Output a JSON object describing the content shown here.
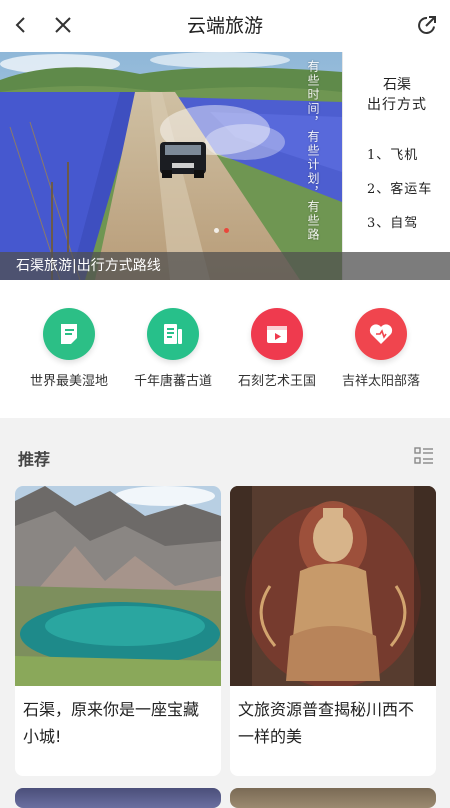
{
  "header": {
    "title": "云端旅游"
  },
  "banner": {
    "caption": "石渠旅游|出行方式路线",
    "panel_title_line1": "石渠",
    "panel_title_line2": "出行方式",
    "panel_items": [
      "1、飞机",
      "2、客运车",
      "3、自驾"
    ],
    "vertical_text": "有些时间，有些计划，有些路",
    "slide_count": 2,
    "active_slide": 2
  },
  "categories": [
    {
      "label": "世界最美湿地",
      "icon": "document-icon",
      "color": "#2cbf86"
    },
    {
      "label": "千年唐蕃古道",
      "icon": "book-list-icon",
      "color": "#27c08a"
    },
    {
      "label": "石刻艺术王国",
      "icon": "video-clip-icon",
      "color": "#ef3a4e"
    },
    {
      "label": "吉祥太阳部落",
      "icon": "heart-icon",
      "color": "#f0454e"
    }
  ],
  "recommend": {
    "title": "推荐",
    "cards": [
      {
        "text": "石渠，原来你是一座宝藏小城!"
      },
      {
        "text": "文旅资源普查揭秘川西不一样的美"
      }
    ]
  },
  "colors": {
    "accent_red": "#e9473b",
    "green": "#2cbf86",
    "red": "#ef3a4e"
  }
}
